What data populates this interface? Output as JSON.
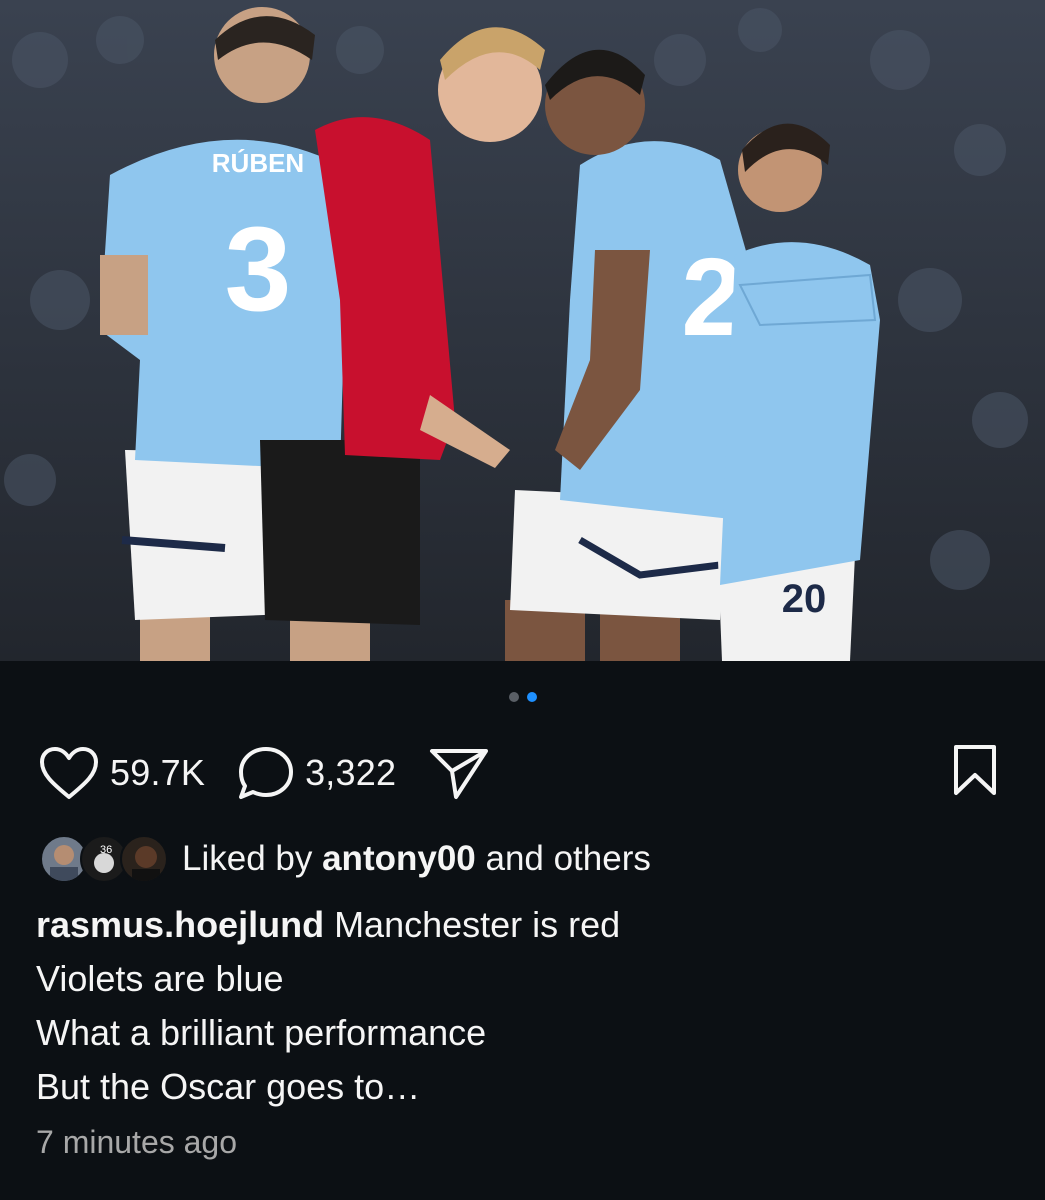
{
  "post": {
    "image_alt": "Football players in sky blue and red shirts arguing on the pitch",
    "jersey_texts": [
      "RÚBEN",
      "3",
      "2",
      "20"
    ],
    "carousel": {
      "count": 2,
      "active_index": 1
    }
  },
  "actions": {
    "like_icon": "heart-icon",
    "likes": "59.7K",
    "comment_icon": "comment-icon",
    "comments": "3,322",
    "share_icon": "send-icon",
    "save_icon": "bookmark-icon"
  },
  "liked_by": {
    "prefix": "Liked by ",
    "user": "antony00",
    "suffix": " and others",
    "avatar_badge": "36"
  },
  "caption": {
    "username": "rasmus.hoejlund",
    "lines": [
      " Manchester is red",
      "Violets are blue",
      "What a brilliant performance",
      "But the Oscar goes to…"
    ]
  },
  "timestamp": "7 minutes ago",
  "colors": {
    "background": "#0c1014",
    "accent_dot": "#1e90ff",
    "city_blue": "#8fc6ee",
    "united_red": "#c8102e"
  }
}
